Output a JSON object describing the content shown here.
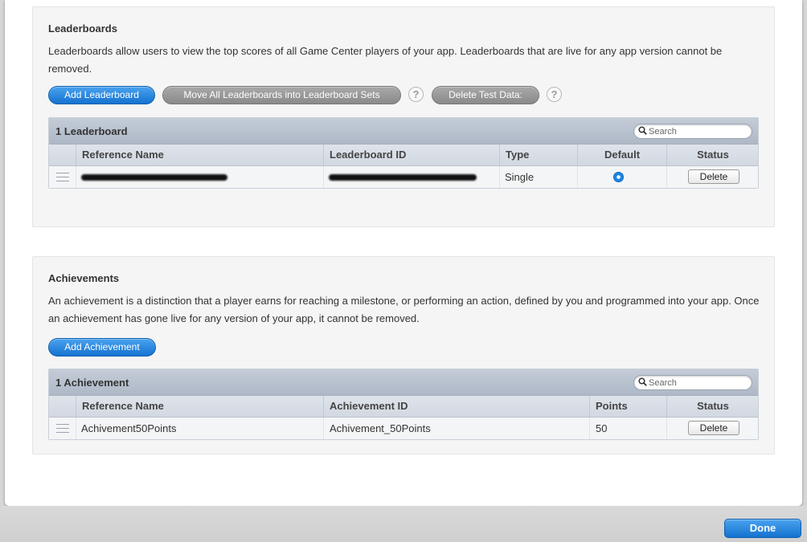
{
  "leaderboards": {
    "title": "Leaderboards",
    "description": "Leaderboards allow users to view the top scores of all Game Center players of your app. Leaderboards that are live for any app version cannot be removed.",
    "add_button": "Add Leaderboard",
    "move_button": "Move All Leaderboards into Leaderboard Sets",
    "delete_test_button": "Delete Test Data:",
    "help_glyph": "?",
    "table": {
      "count": "1 Leaderboard",
      "search_placeholder": "Search",
      "columns": [
        "Reference Name",
        "Leaderboard ID",
        "Type",
        "Default",
        "Status"
      ],
      "rows": [
        {
          "type": "Single",
          "default_selected": true,
          "status_button": "Delete"
        }
      ]
    }
  },
  "achievements": {
    "title": "Achievements",
    "description": "An achievement is a distinction that a player earns for reaching a milestone, or performing an action, defined by you and programmed into your app. Once an achievement has gone live for any version of your app, it cannot be removed.",
    "add_button": "Add Achievement",
    "table": {
      "count": "1 Achievement",
      "search_placeholder": "Search",
      "columns": [
        "Reference Name",
        "Achievement ID",
        "Points",
        "Status"
      ],
      "rows": [
        {
          "reference_name": "Achivement50Points",
          "achievement_id": "Achivement_50Points",
          "points": "50",
          "status_button": "Delete"
        }
      ]
    }
  },
  "footer": {
    "done_button": "Done"
  },
  "colors": {
    "accent_blue": "#1472d0",
    "header_gray": "#b6bfcc"
  }
}
